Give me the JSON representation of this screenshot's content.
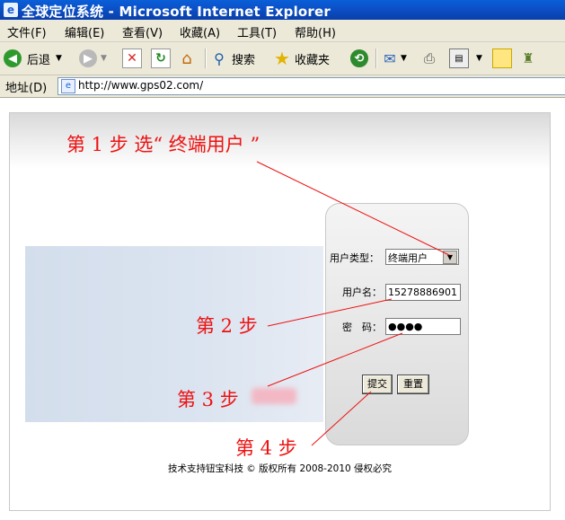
{
  "window": {
    "title": "全球定位系统 - Microsoft Internet Explorer",
    "icon": "ie-icon"
  },
  "menu": [
    "文件(F)",
    "编辑(E)",
    "查看(V)",
    "收藏(A)",
    "工具(T)",
    "帮助(H)"
  ],
  "toolbar": {
    "back": "后退",
    "search": "搜索",
    "favorites": "收藏夹"
  },
  "address": {
    "label": "地址(D)",
    "url": "http://www.gps02.com/"
  },
  "login": {
    "user_type_label": "用户类型：",
    "user_type_value": "终端用户",
    "username_label": "用户名：",
    "username_value": "15278886901",
    "password_label": "密　码：",
    "password_value": "●●●●",
    "submit_label": "提交",
    "reset_label": "重置"
  },
  "footer": "技术支持钮宝科技 © 版权所有  2008-2010 侵权必究",
  "annotations": {
    "step1": "第 1 步  选“ 终端用户 ”",
    "step2": "第 2 步",
    "step3": "第 3 步",
    "step4": "第 4 步"
  },
  "colors": {
    "annotation_red": "#e11111",
    "titlebar_blue": "#0b4ec4",
    "chrome_beige": "#ece9d8"
  }
}
